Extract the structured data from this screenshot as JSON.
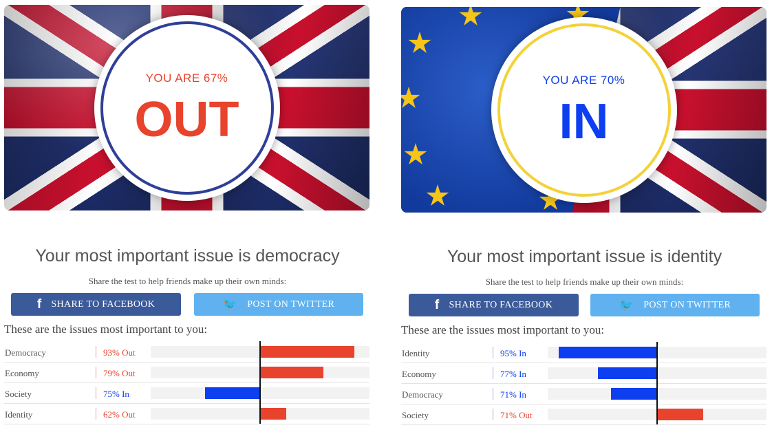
{
  "results": [
    {
      "flag": "uk",
      "pct_text": "YOU ARE 67%",
      "result": "OUT",
      "result_color": "#e8432d",
      "ring_color": "#2f3f98",
      "issue_heading": "Your most important issue is democracy",
      "share_text": "Share the test to help friends make up their own minds:",
      "facebook_label": "SHARE TO FACEBOOK",
      "twitter_label": "POST ON TWITTER",
      "facebook_icon": "facebook-icon",
      "twitter_icon": "twitter-icon",
      "list_heading": "These are the issues most important to you:",
      "issues": [
        {
          "name": "Democracy",
          "value_text": "93% Out",
          "side": "out",
          "percent": 93
        },
        {
          "name": "Economy",
          "value_text": "79% Out",
          "side": "out",
          "percent": 79
        },
        {
          "name": "Society",
          "value_text": "75% In",
          "side": "in",
          "percent": 75
        },
        {
          "name": "Identity",
          "value_text": "62% Out",
          "side": "out",
          "percent": 62
        }
      ]
    },
    {
      "flag": "eu-uk",
      "pct_text": "YOU ARE 70%",
      "result": "IN",
      "result_color": "#0d3ff0",
      "ring_color": "#f3d23a",
      "issue_heading": "Your most important issue is identity",
      "share_text": "Share the test to help friends make up their own minds:",
      "facebook_label": "SHARE TO FACEBOOK",
      "twitter_label": "POST ON TWITTER",
      "facebook_icon": "facebook-icon",
      "twitter_icon": "twitter-icon",
      "list_heading": "These are the issues most important to you:",
      "issues": [
        {
          "name": "Identity",
          "value_text": "95% In",
          "side": "in",
          "percent": 95
        },
        {
          "name": "Economy",
          "value_text": "77% In",
          "side": "in",
          "percent": 77
        },
        {
          "name": "Democracy",
          "value_text": "71% In",
          "side": "in",
          "percent": 71
        },
        {
          "name": "Society",
          "value_text": "71% Out",
          "side": "out",
          "percent": 71
        }
      ]
    }
  ],
  "colors": {
    "out": "#e8432d",
    "in": "#0d3ff0",
    "facebook": "#3b5a9a",
    "twitter": "#5fb2ef"
  }
}
